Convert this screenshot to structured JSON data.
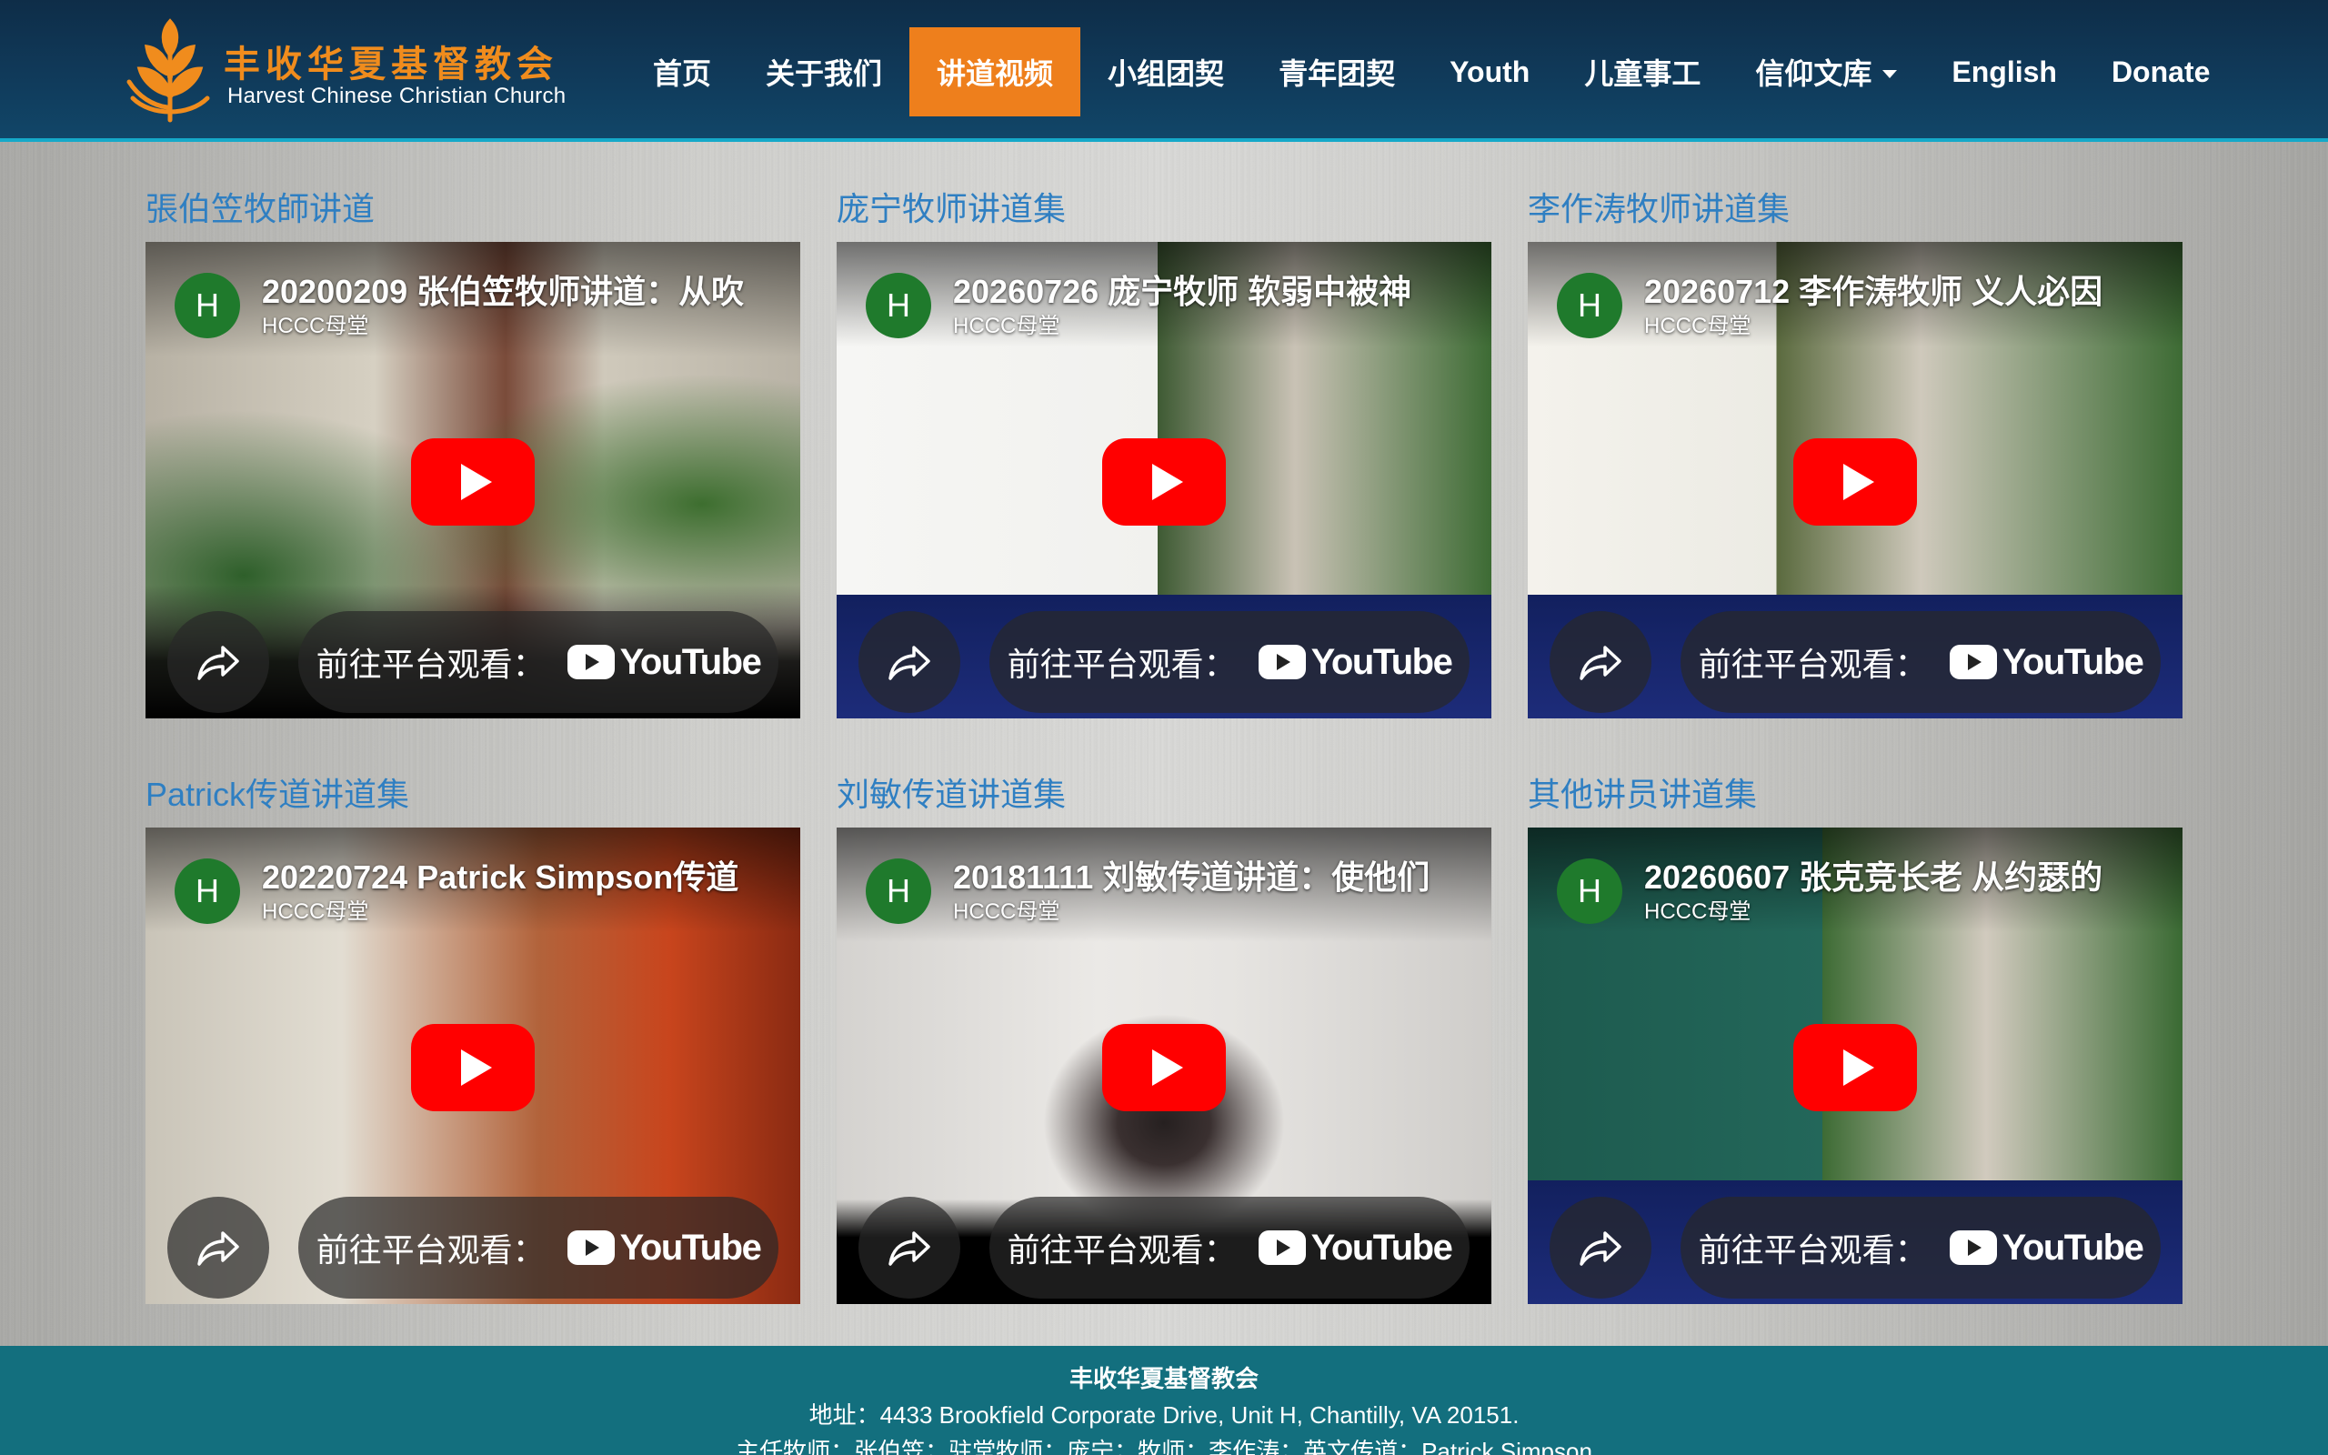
{
  "header": {
    "logo": {
      "name_cn": "丰收华夏基督教会",
      "name_en": "Harvest Chinese Christian Church",
      "accent_color": "#f08c1d"
    },
    "nav": [
      {
        "label": "首页",
        "active": false
      },
      {
        "label": "关于我们",
        "active": false
      },
      {
        "label": "讲道视频",
        "active": true
      },
      {
        "label": "小组团契",
        "active": false
      },
      {
        "label": "青年团契",
        "active": false
      },
      {
        "label": "Youth",
        "active": false
      },
      {
        "label": "儿童事工",
        "active": false
      },
      {
        "label": "信仰文库",
        "active": false,
        "dropdown": true
      },
      {
        "label": "English",
        "active": false
      },
      {
        "label": "Donate",
        "active": false
      }
    ],
    "active_color": "#ee7f1c"
  },
  "sections": [
    {
      "title": "張伯笠牧師讲道",
      "video": {
        "avatar_letter": "H",
        "title": "20200209 张伯笠牧师讲道：从吹",
        "channel": "HCCC母堂"
      }
    },
    {
      "title": "庞宁牧师讲道集",
      "video": {
        "avatar_letter": "H",
        "title": "20260726 庞宁牧师 软弱中被神",
        "channel": "HCCC母堂"
      }
    },
    {
      "title": "李作涛牧师讲道集",
      "video": {
        "avatar_letter": "H",
        "title": "20260712 李作涛牧师 义人必因",
        "channel": "HCCC母堂"
      }
    },
    {
      "title": "Patrick传道讲道集",
      "video": {
        "avatar_letter": "H",
        "title": "20220724 Patrick Simpson传道",
        "channel": "HCCC母堂"
      }
    },
    {
      "title": "刘敏传道讲道集",
      "video": {
        "avatar_letter": "H",
        "title": "20181111 刘敏传道讲道：使他们",
        "channel": "HCCC母堂"
      }
    },
    {
      "title": "其他讲员讲道集",
      "video": {
        "avatar_letter": "H",
        "title": "20260607 张克竞长老 从约瑟的",
        "channel": "HCCC母堂"
      }
    }
  ],
  "player": {
    "watch_label": "前往平台观看：",
    "platform": "YouTube",
    "share_icon": "share-icon",
    "play_icon": "play-icon",
    "play_color": "#ff0000"
  },
  "footer": {
    "org": "丰收华夏基督教会",
    "address": "地址：4433 Brookfield Corporate Drive, Unit H, Chantilly, VA 20151.",
    "staff": "主任牧师：张伯笠；驻堂牧师：庞宁；牧师：李作涛；英文传道：Patrick Simpson",
    "bg_color": "#136f7e"
  }
}
